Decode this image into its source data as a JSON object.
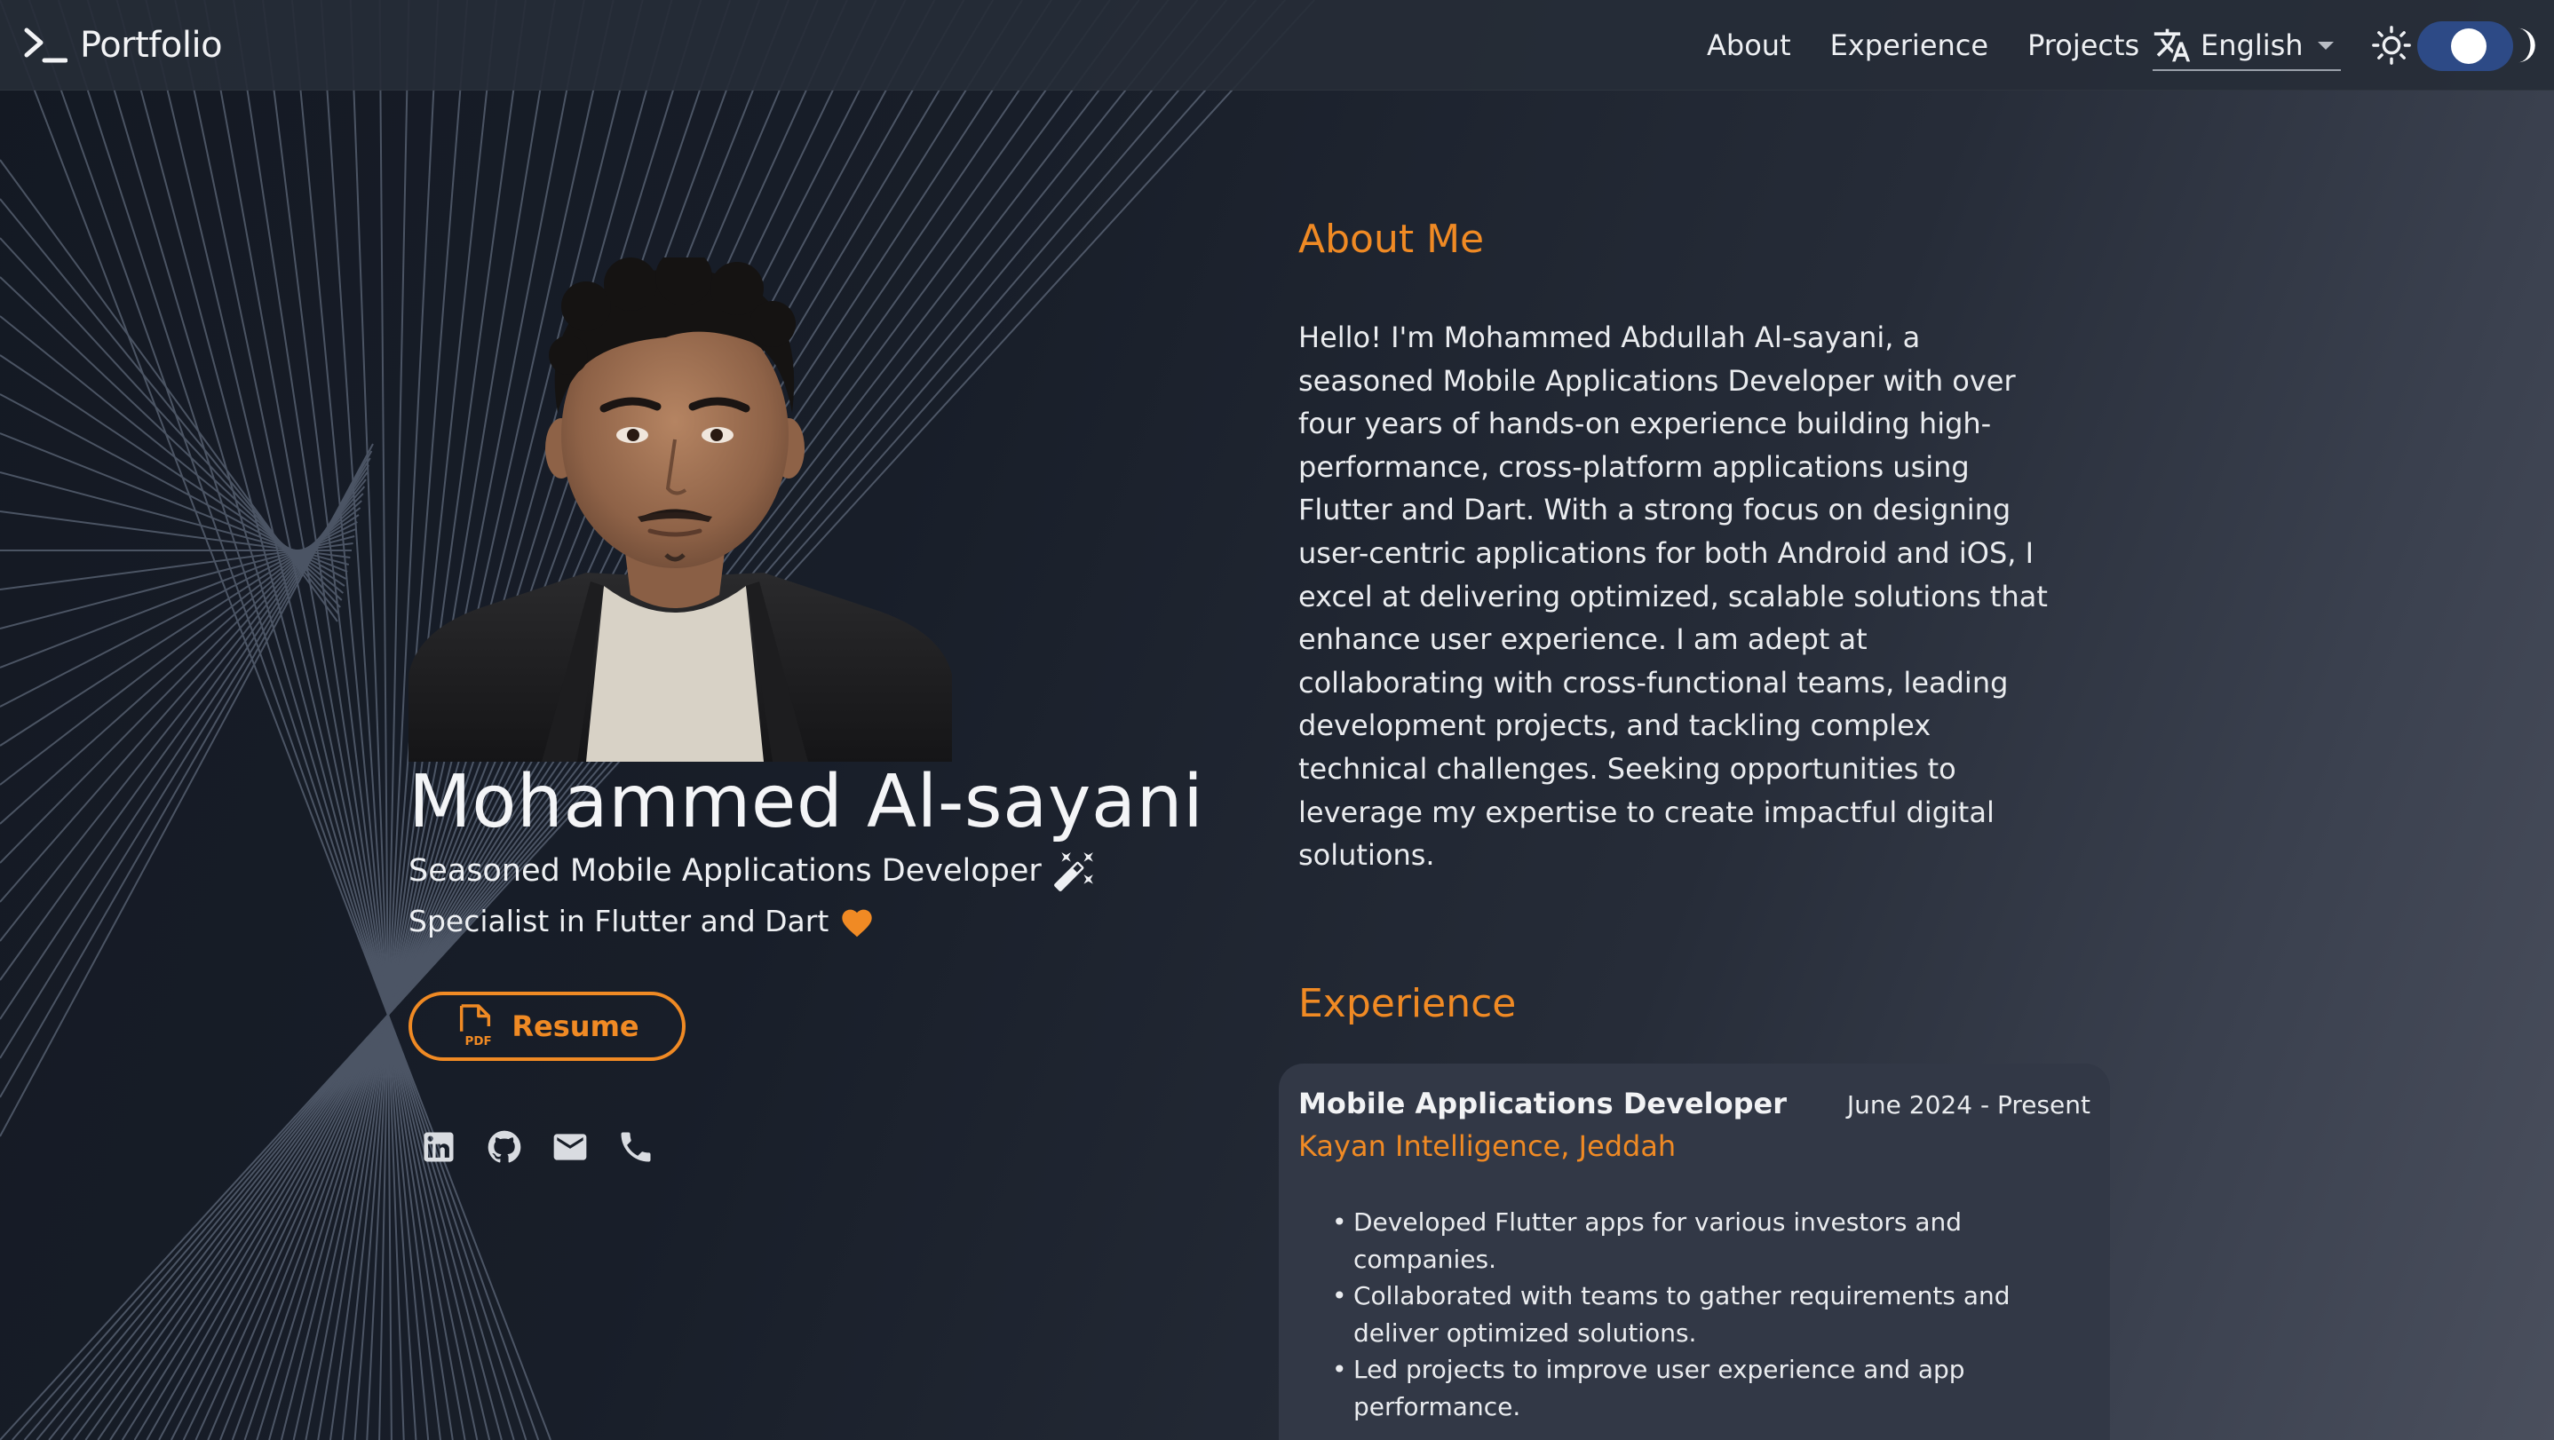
{
  "colors": {
    "accent": "#f08a24",
    "toggle_track": "#2d4a86",
    "navbar_bg": "#262c37",
    "card_bg": "#323846"
  },
  "navbar": {
    "brand": "Portfolio",
    "brand_icon": "terminal-prompt-icon",
    "links": [
      "About",
      "Experience",
      "Projects"
    ],
    "language": {
      "icon": "translate-icon",
      "selected": "English"
    },
    "theme_toggle": {
      "left_icon": "sun-icon",
      "right_icon": "moon-icon",
      "state": "dark"
    }
  },
  "profile": {
    "avatar": "profile-photo",
    "name": "Mohammed Al-sayani",
    "tagline": "Seasoned Mobile Applications Developer",
    "tagline_icon": "magic-wand-icon",
    "subtitle": "Specialist in Flutter and Dart",
    "subtitle_icon": "heart-icon",
    "resume_button": {
      "label": "Resume",
      "icon": "pdf-file-icon"
    },
    "socials": [
      "linkedin-icon",
      "github-icon",
      "email-icon",
      "phone-icon"
    ]
  },
  "about": {
    "title": "About Me",
    "text": "Hello! I'm Mohammed Abdullah Al-sayani, a seasoned Mobile Applications Developer with over four years of hands-on experience building high-performance, cross-platform applications using Flutter and Dart. With a strong focus on designing user-centric applications for both Android and iOS, I excel at delivering optimized, scalable solutions that enhance user experience. I am adept at collaborating with cross-functional teams, leading development projects, and tackling complex technical challenges. Seeking opportunities to leverage my expertise to create impactful digital solutions."
  },
  "experience": {
    "title": "Experience",
    "jobs": [
      {
        "title": "Mobile Applications Developer",
        "dates": "June 2024 - Present",
        "company": "Kayan Intelligence, Jeddah",
        "bullets": [
          "Developed Flutter apps for various investors and companies.",
          "Collaborated with teams to gather requirements and deliver optimized solutions.",
          "Led projects to improve user experience and app performance."
        ]
      }
    ]
  }
}
